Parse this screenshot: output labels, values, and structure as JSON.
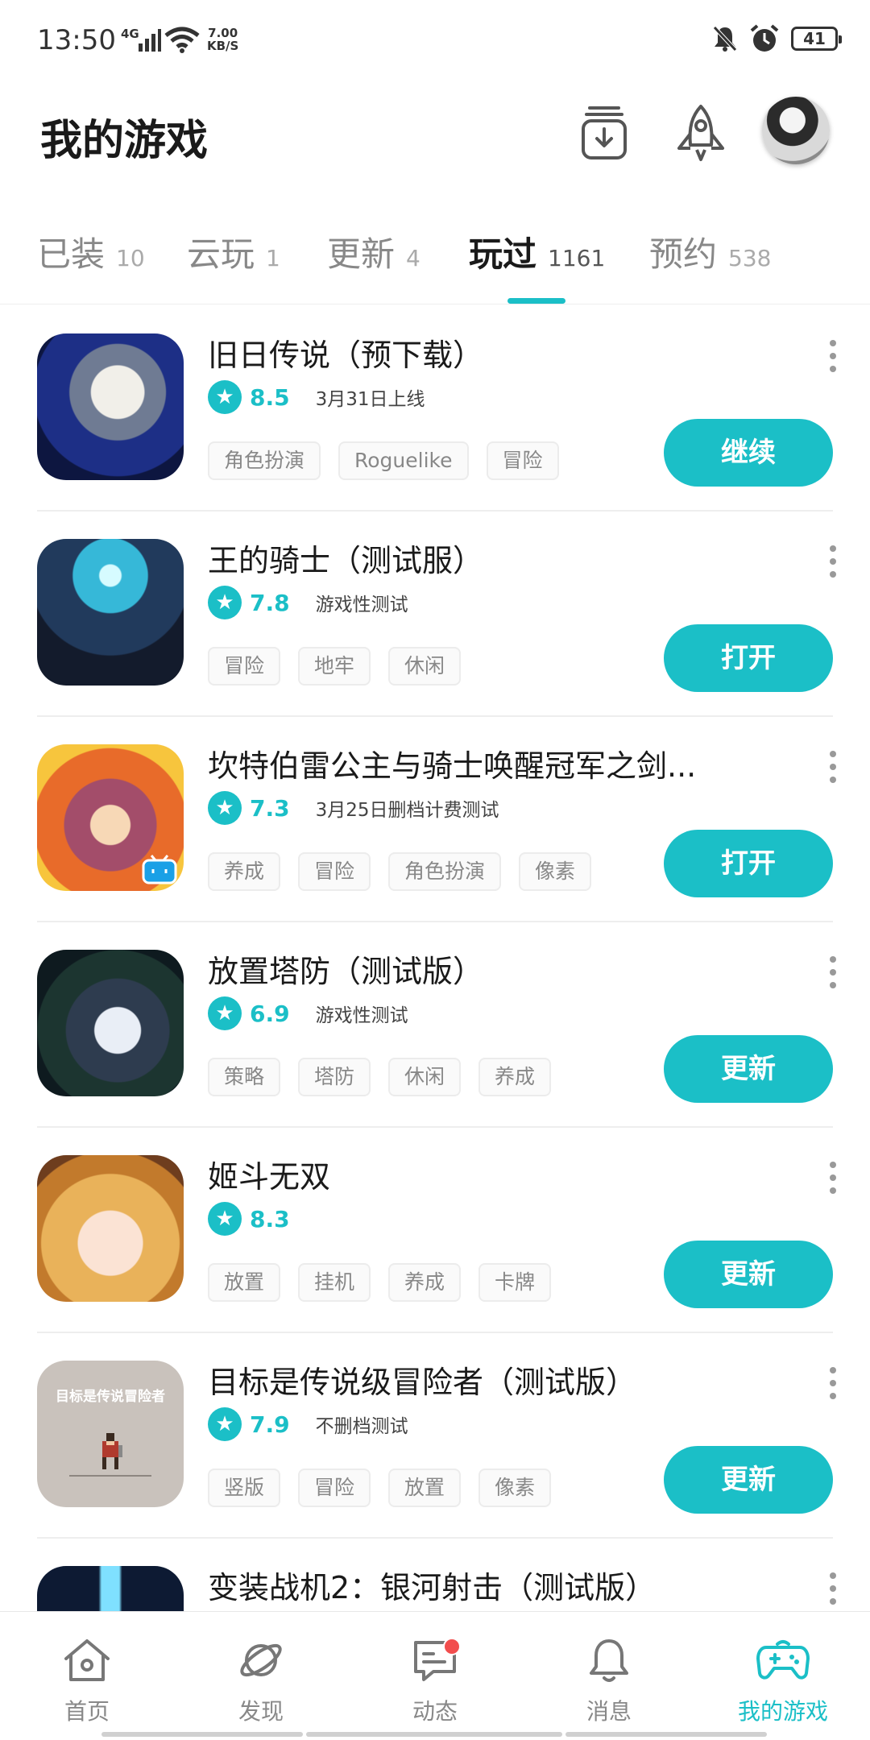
{
  "status_bar": {
    "time": "13:50",
    "signal": "4G",
    "speed_value": "7.00",
    "speed_unit": "KB/S",
    "battery": "41"
  },
  "header": {
    "title": "我的游戏"
  },
  "tabs": [
    {
      "label": "已装",
      "count": "10"
    },
    {
      "label": "云玩",
      "count": "1"
    },
    {
      "label": "更新",
      "count": "4"
    },
    {
      "label": "玩过",
      "count": "1161",
      "active": true
    },
    {
      "label": "预约",
      "count": "538"
    }
  ],
  "games": [
    {
      "name": "旧日传说（预下载）",
      "score": "8.5",
      "note": "3月31日上线",
      "tags": [
        "角色扮演",
        "Roguelike",
        "冒险"
      ],
      "action": "继续"
    },
    {
      "name": "王的骑士（测试服）",
      "score": "7.8",
      "note": "游戏性测试",
      "tags": [
        "冒险",
        "地牢",
        "休闲"
      ],
      "action": "打开"
    },
    {
      "name": "坎特伯雷公主与骑士唤醒冠军之剑...",
      "score": "7.3",
      "note": "3月25日删档计费测试",
      "tags": [
        "养成",
        "冒险",
        "角色扮演",
        "像素"
      ],
      "action": "打开"
    },
    {
      "name": "放置塔防（测试版）",
      "score": "6.9",
      "note": "游戏性测试",
      "tags": [
        "策略",
        "塔防",
        "休闲",
        "养成"
      ],
      "action": "更新"
    },
    {
      "name": "姬斗无双",
      "score": "8.3",
      "note": "",
      "tags": [
        "放置",
        "挂机",
        "养成",
        "卡牌"
      ],
      "action": "更新"
    },
    {
      "name": "目标是传说级冒险者（测试版）",
      "score": "7.9",
      "note": "不删档测试",
      "tags": [
        "竖版",
        "冒险",
        "放置",
        "像素"
      ],
      "action": "更新",
      "icon_text": "目标是传说冒险者"
    },
    {
      "name": "变装战机2：银河射击（测试版）",
      "score": "",
      "note": "",
      "tags": [],
      "action": ""
    }
  ],
  "bottom_nav": [
    {
      "label": "首页",
      "icon": "home-icon"
    },
    {
      "label": "发现",
      "icon": "planet-icon"
    },
    {
      "label": "动态",
      "icon": "chat-icon",
      "badge": true
    },
    {
      "label": "消息",
      "icon": "bell-icon"
    },
    {
      "label": "我的游戏",
      "icon": "gamepad-icon",
      "active": true
    }
  ],
  "colors": {
    "accent": "#1bbfc7",
    "badge": "#f24d4d"
  }
}
